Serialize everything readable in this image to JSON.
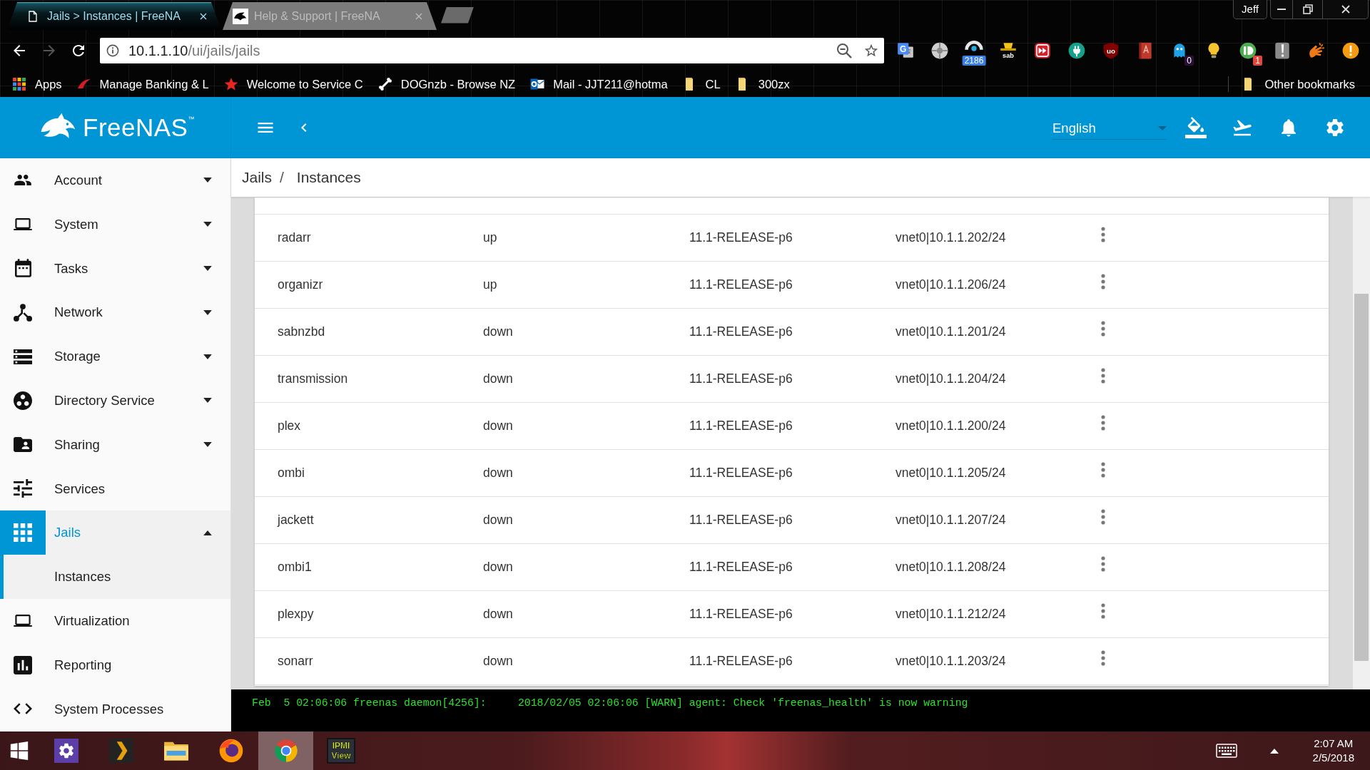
{
  "browser": {
    "tabs": [
      {
        "kind": "page",
        "title": "Jails > Instances | FreeNA",
        "selected": true
      },
      {
        "kind": "logo",
        "title": "Help & Support | FreeNA",
        "selected": false
      }
    ],
    "profile": "Jeff",
    "address": {
      "host": "10.1.1.10",
      "path": "/ui/jails/jails"
    },
    "extensions": [
      {
        "kind": "translate",
        "label": "G"
      },
      {
        "kind": "aperture"
      },
      {
        "kind": "gauge",
        "badge": "2186"
      },
      {
        "kind": "sab",
        "label": "sab"
      },
      {
        "kind": "playback"
      },
      {
        "kind": "plug"
      },
      {
        "kind": "shield",
        "label": "uo"
      },
      {
        "kind": "book"
      },
      {
        "kind": "ghost",
        "badge": "0"
      },
      {
        "kind": "bulb"
      },
      {
        "kind": "pushbullet",
        "badge": "1"
      },
      {
        "kind": "tile"
      },
      {
        "kind": "hand"
      },
      {
        "kind": "alert"
      }
    ],
    "bookmarks": [
      {
        "kind": "apps",
        "label": "Apps"
      },
      {
        "kind": "swoosh",
        "label": "Manage Banking & L"
      },
      {
        "kind": "star",
        "label": "Welcome to Service C"
      },
      {
        "kind": "bone",
        "label": "DOGnzb - Browse NZ"
      },
      {
        "kind": "mail",
        "label": "Mail - JJT211@hotma"
      },
      {
        "kind": "folder",
        "label": "CL"
      },
      {
        "kind": "folder",
        "label": "300zx"
      }
    ],
    "other_bookmarks": "Other bookmarks"
  },
  "header": {
    "logo": "FreeNAS$^{™}$",
    "language": "English"
  },
  "breadcrumb": {
    "items": [
      "Jails",
      "Instances"
    ],
    "separator": "/"
  },
  "sidebar": {
    "items": [
      {
        "kind": "menu",
        "label": "Account",
        "expanded": false,
        "selected": false
      },
      {
        "kind": "menu",
        "label": "System",
        "expanded": false,
        "selected": false
      },
      {
        "kind": "menu",
        "label": "Tasks",
        "expanded": false,
        "selected": false
      },
      {
        "kind": "menu",
        "label": "Network",
        "expanded": false,
        "selected": false
      },
      {
        "kind": "menu",
        "label": "Storage",
        "expanded": false,
        "selected": false
      },
      {
        "kind": "menu",
        "label": "Directory Service",
        "expanded": false,
        "selected": false
      },
      {
        "kind": "menu",
        "label": "Sharing",
        "expanded": false,
        "selected": false
      },
      {
        "kind": "link",
        "label": "Services",
        "selected": false
      },
      {
        "kind": "menu",
        "label": "Jails",
        "expanded": true,
        "selected": true,
        "children": [
          {
            "label": "Instances",
            "selected": true
          }
        ]
      },
      {
        "kind": "link",
        "label": "Virtualization",
        "selected": false
      },
      {
        "kind": "link",
        "label": "Reporting",
        "selected": false
      },
      {
        "kind": "link",
        "label": "System Processes",
        "selected": false
      }
    ]
  },
  "jails": {
    "rows": [
      {
        "column_1": "radarr",
        "column_2": "up",
        "column_3": "11.1-RELEASE-p6",
        "column_4": "vnet0|10.1.1.202/24"
      },
      {
        "column_1": "organizr",
        "column_2": "up",
        "column_3": "11.1-RELEASE-p6",
        "column_4": "vnet0|10.1.1.206/24"
      },
      {
        "column_1": "sabnzbd",
        "column_2": "down",
        "column_3": "11.1-RELEASE-p6",
        "column_4": "vnet0|10.1.1.201/24"
      },
      {
        "column_1": "transmission",
        "column_2": "down",
        "column_3": "11.1-RELEASE-p6",
        "column_4": "vnet0|10.1.1.204/24"
      },
      {
        "column_1": "plex",
        "column_2": "down",
        "column_3": "11.1-RELEASE-p6",
        "column_4": "vnet0|10.1.1.200/24"
      },
      {
        "column_1": "ombi",
        "column_2": "down",
        "column_3": "11.1-RELEASE-p6",
        "column_4": "vnet0|10.1.1.205/24"
      },
      {
        "column_1": "jackett",
        "column_2": "down",
        "column_3": "11.1-RELEASE-p6",
        "column_4": "vnet0|10.1.1.207/24"
      },
      {
        "column_1": "ombi1",
        "column_2": "down",
        "column_3": "11.1-RELEASE-p6",
        "column_4": "vnet0|10.1.1.208/24"
      },
      {
        "column_1": "plexpy",
        "column_2": "down",
        "column_3": "11.1-RELEASE-p6",
        "column_4": "vnet0|10.1.1.212/24"
      },
      {
        "column_1": "sonarr",
        "column_2": "down",
        "column_3": "11.1-RELEASE-p6",
        "column_4": "vnet0|10.1.1.203/24"
      }
    ]
  },
  "console": "Feb  5 02:06:06 freenas daemon[4256]:     2018/02/05 02:06:06 [WARN] agent: Check 'freenas_health' is now warning",
  "taskbar": {
    "apps": [
      {
        "kind": "settings",
        "active": false
      },
      {
        "kind": "plex",
        "active": false
      },
      {
        "kind": "explorer",
        "active": false
      },
      {
        "kind": "firefox",
        "active": false
      },
      {
        "kind": "chrome",
        "active": true
      },
      {
        "kind": "ipmi",
        "label": "IPMI View",
        "active": false
      }
    ],
    "time": "2:07 AM",
    "date": "2/5/2018"
  }
}
